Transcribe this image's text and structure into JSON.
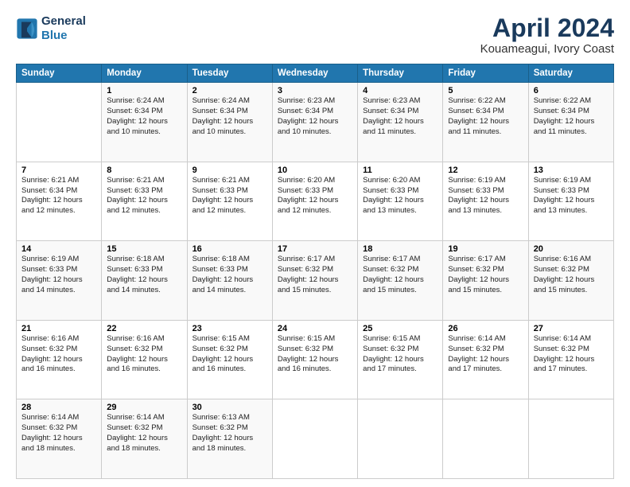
{
  "header": {
    "logo_line1": "General",
    "logo_line2": "Blue",
    "title": "April 2024",
    "subtitle": "Kouameagui, Ivory Coast"
  },
  "calendar": {
    "days_of_week": [
      "Sunday",
      "Monday",
      "Tuesday",
      "Wednesday",
      "Thursday",
      "Friday",
      "Saturday"
    ],
    "weeks": [
      [
        {
          "num": "",
          "detail": ""
        },
        {
          "num": "1",
          "detail": "Sunrise: 6:24 AM\nSunset: 6:34 PM\nDaylight: 12 hours\nand 10 minutes."
        },
        {
          "num": "2",
          "detail": "Sunrise: 6:24 AM\nSunset: 6:34 PM\nDaylight: 12 hours\nand 10 minutes."
        },
        {
          "num": "3",
          "detail": "Sunrise: 6:23 AM\nSunset: 6:34 PM\nDaylight: 12 hours\nand 10 minutes."
        },
        {
          "num": "4",
          "detail": "Sunrise: 6:23 AM\nSunset: 6:34 PM\nDaylight: 12 hours\nand 11 minutes."
        },
        {
          "num": "5",
          "detail": "Sunrise: 6:22 AM\nSunset: 6:34 PM\nDaylight: 12 hours\nand 11 minutes."
        },
        {
          "num": "6",
          "detail": "Sunrise: 6:22 AM\nSunset: 6:34 PM\nDaylight: 12 hours\nand 11 minutes."
        }
      ],
      [
        {
          "num": "7",
          "detail": "Sunrise: 6:21 AM\nSunset: 6:34 PM\nDaylight: 12 hours\nand 12 minutes."
        },
        {
          "num": "8",
          "detail": "Sunrise: 6:21 AM\nSunset: 6:33 PM\nDaylight: 12 hours\nand 12 minutes."
        },
        {
          "num": "9",
          "detail": "Sunrise: 6:21 AM\nSunset: 6:33 PM\nDaylight: 12 hours\nand 12 minutes."
        },
        {
          "num": "10",
          "detail": "Sunrise: 6:20 AM\nSunset: 6:33 PM\nDaylight: 12 hours\nand 12 minutes."
        },
        {
          "num": "11",
          "detail": "Sunrise: 6:20 AM\nSunset: 6:33 PM\nDaylight: 12 hours\nand 13 minutes."
        },
        {
          "num": "12",
          "detail": "Sunrise: 6:19 AM\nSunset: 6:33 PM\nDaylight: 12 hours\nand 13 minutes."
        },
        {
          "num": "13",
          "detail": "Sunrise: 6:19 AM\nSunset: 6:33 PM\nDaylight: 12 hours\nand 13 minutes."
        }
      ],
      [
        {
          "num": "14",
          "detail": "Sunrise: 6:19 AM\nSunset: 6:33 PM\nDaylight: 12 hours\nand 14 minutes."
        },
        {
          "num": "15",
          "detail": "Sunrise: 6:18 AM\nSunset: 6:33 PM\nDaylight: 12 hours\nand 14 minutes."
        },
        {
          "num": "16",
          "detail": "Sunrise: 6:18 AM\nSunset: 6:33 PM\nDaylight: 12 hours\nand 14 minutes."
        },
        {
          "num": "17",
          "detail": "Sunrise: 6:17 AM\nSunset: 6:32 PM\nDaylight: 12 hours\nand 15 minutes."
        },
        {
          "num": "18",
          "detail": "Sunrise: 6:17 AM\nSunset: 6:32 PM\nDaylight: 12 hours\nand 15 minutes."
        },
        {
          "num": "19",
          "detail": "Sunrise: 6:17 AM\nSunset: 6:32 PM\nDaylight: 12 hours\nand 15 minutes."
        },
        {
          "num": "20",
          "detail": "Sunrise: 6:16 AM\nSunset: 6:32 PM\nDaylight: 12 hours\nand 15 minutes."
        }
      ],
      [
        {
          "num": "21",
          "detail": "Sunrise: 6:16 AM\nSunset: 6:32 PM\nDaylight: 12 hours\nand 16 minutes."
        },
        {
          "num": "22",
          "detail": "Sunrise: 6:16 AM\nSunset: 6:32 PM\nDaylight: 12 hours\nand 16 minutes."
        },
        {
          "num": "23",
          "detail": "Sunrise: 6:15 AM\nSunset: 6:32 PM\nDaylight: 12 hours\nand 16 minutes."
        },
        {
          "num": "24",
          "detail": "Sunrise: 6:15 AM\nSunset: 6:32 PM\nDaylight: 12 hours\nand 16 minutes."
        },
        {
          "num": "25",
          "detail": "Sunrise: 6:15 AM\nSunset: 6:32 PM\nDaylight: 12 hours\nand 17 minutes."
        },
        {
          "num": "26",
          "detail": "Sunrise: 6:14 AM\nSunset: 6:32 PM\nDaylight: 12 hours\nand 17 minutes."
        },
        {
          "num": "27",
          "detail": "Sunrise: 6:14 AM\nSunset: 6:32 PM\nDaylight: 12 hours\nand 17 minutes."
        }
      ],
      [
        {
          "num": "28",
          "detail": "Sunrise: 6:14 AM\nSunset: 6:32 PM\nDaylight: 12 hours\nand 18 minutes."
        },
        {
          "num": "29",
          "detail": "Sunrise: 6:14 AM\nSunset: 6:32 PM\nDaylight: 12 hours\nand 18 minutes."
        },
        {
          "num": "30",
          "detail": "Sunrise: 6:13 AM\nSunset: 6:32 PM\nDaylight: 12 hours\nand 18 minutes."
        },
        {
          "num": "",
          "detail": ""
        },
        {
          "num": "",
          "detail": ""
        },
        {
          "num": "",
          "detail": ""
        },
        {
          "num": "",
          "detail": ""
        }
      ]
    ]
  }
}
